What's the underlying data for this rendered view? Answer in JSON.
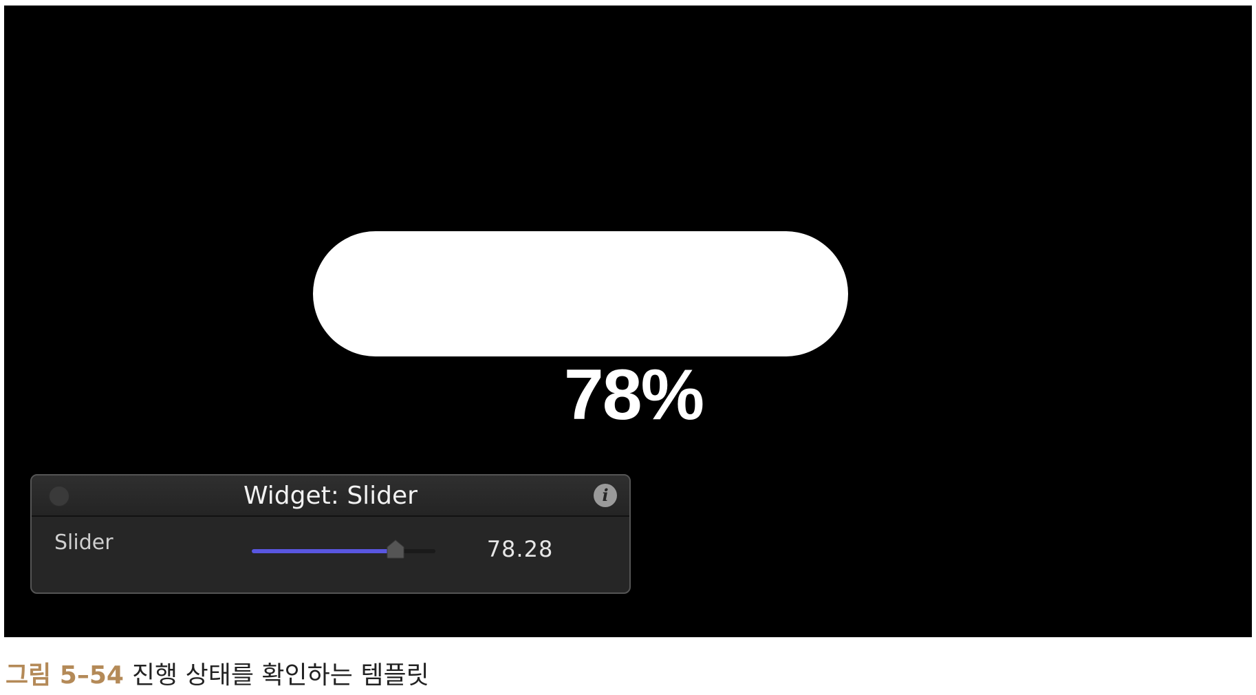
{
  "preview": {
    "percent_text": "78%",
    "progress_fraction": 0.78
  },
  "hud": {
    "title": "Widget: Slider",
    "info_icon": "i",
    "slider_label": "Slider",
    "slider_value_text": "78.28",
    "slider_value": 78.28,
    "slider_min": 0,
    "slider_max": 100
  },
  "caption": {
    "figure_number": "그림 5–54",
    "text": "진행 상태를 확인하는 템플릿"
  },
  "colors": {
    "canvas_background": "#000000",
    "bar_fill": "#ffffff",
    "slider_accent": "#5956e0",
    "caption_number": "#b48a58"
  }
}
